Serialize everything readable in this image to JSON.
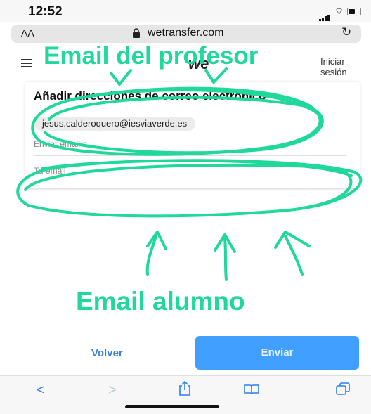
{
  "status_bar": {
    "time": "12:52"
  },
  "browser": {
    "text_size": "AA",
    "domain": "wetransfer.com"
  },
  "site": {
    "logo": "we",
    "login": "Iniciar sesión"
  },
  "card": {
    "title": "Añadir direcciones de correo electrónico",
    "email_chip": "jesus.calderoquero@iesviaverde.es",
    "send_to_label": "Enviar email a",
    "your_email_placeholder": "Tu email"
  },
  "annotations": {
    "teacher": "Email del profesor",
    "student": "Email alumno",
    "color": "#1fd89a"
  },
  "actions": {
    "back": "Volver",
    "send": "Enviar",
    "send_color": "#409fff"
  },
  "toolbar": {
    "back_icon": "chevron-left",
    "forward_icon": "chevron-right",
    "share_icon": "share",
    "bookmarks_icon": "book",
    "tabs_icon": "tabs"
  }
}
